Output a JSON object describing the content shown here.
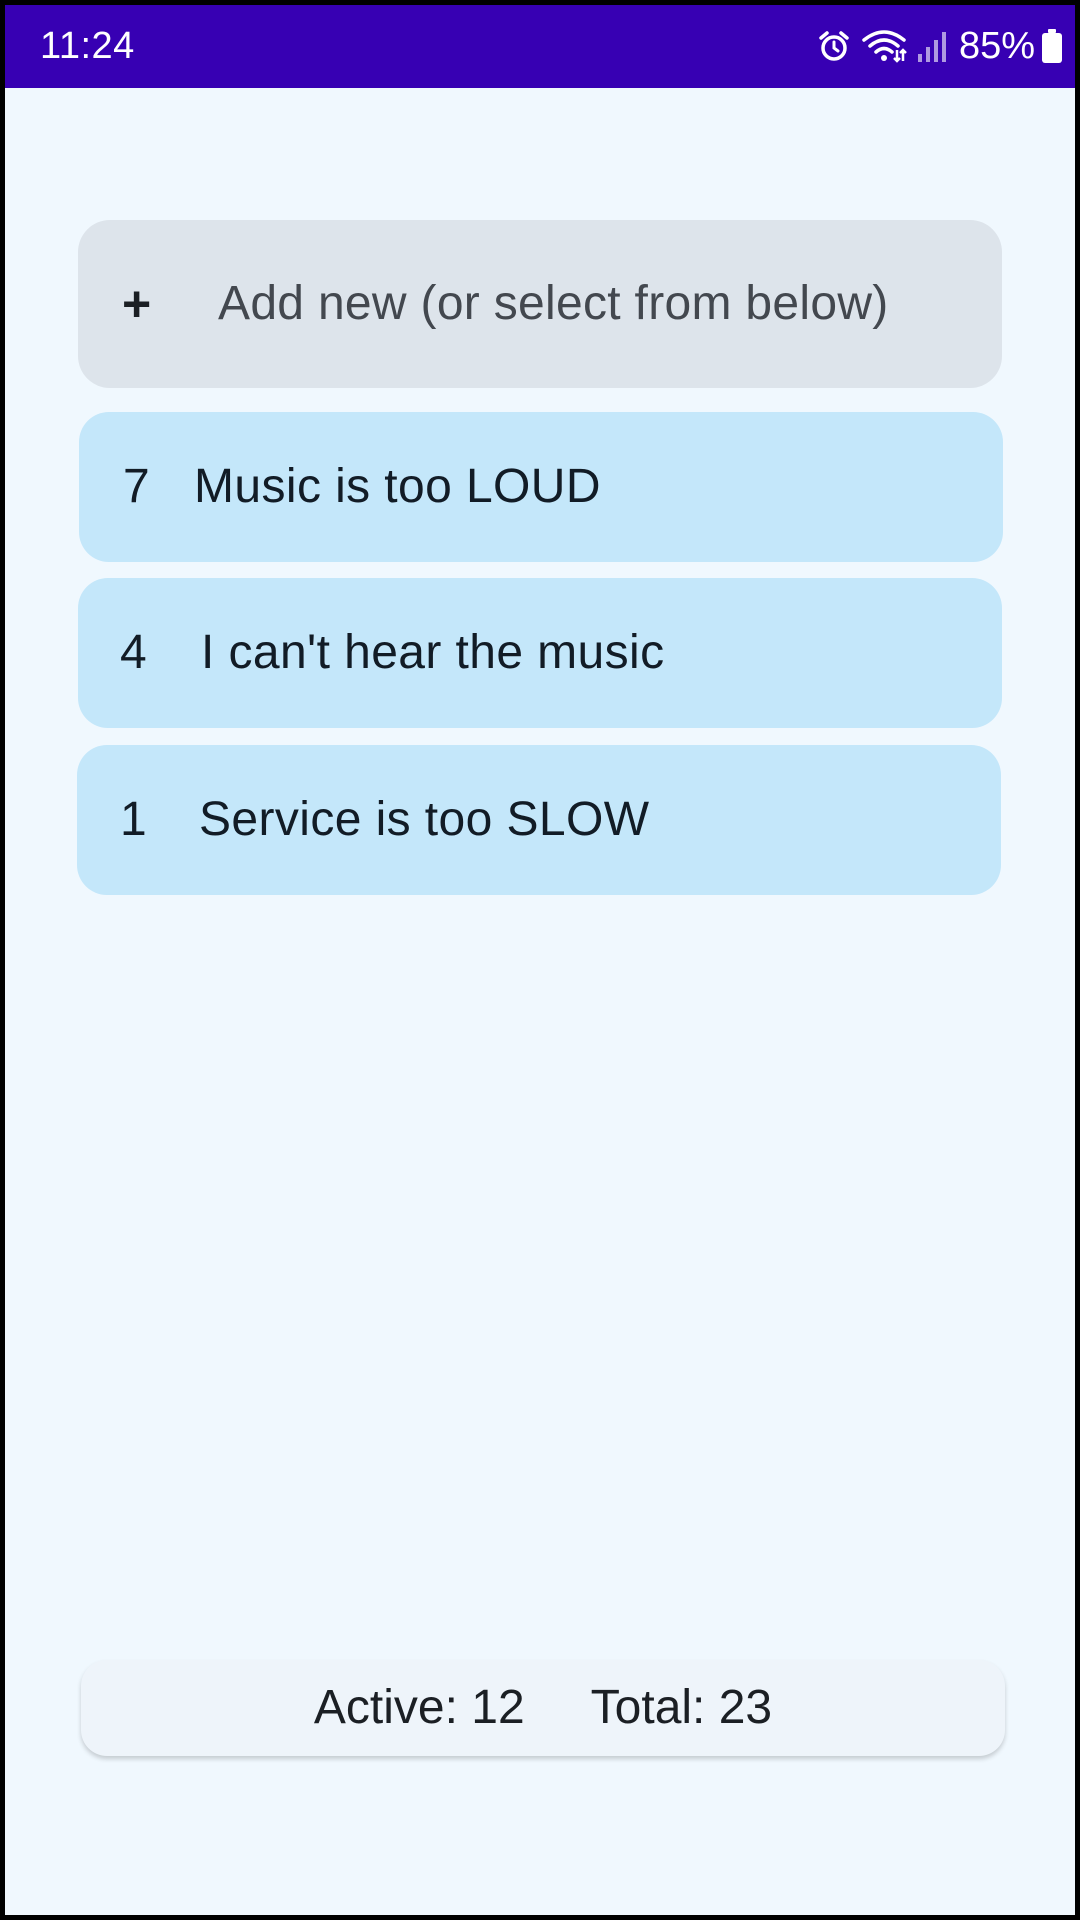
{
  "status_bar": {
    "time": "11:24",
    "battery_percent": "85%",
    "icons": [
      "alarm-icon",
      "wifi-icon",
      "signal-icon",
      "battery-icon"
    ],
    "background": "#3700b3"
  },
  "add_new": {
    "icon": "+",
    "label": "Add new (or select from below)"
  },
  "items": [
    {
      "count": "7",
      "label": "Music is too LOUD"
    },
    {
      "count": "4",
      "label": "I can't hear the music"
    },
    {
      "count": "1",
      "label": "Service is too SLOW"
    }
  ],
  "stats": {
    "active": "Active: 12",
    "total": "Total: 23"
  },
  "colors": {
    "background": "#f0f8fe",
    "item_background": "#c4e7fa",
    "add_background": "#dde4eb"
  }
}
